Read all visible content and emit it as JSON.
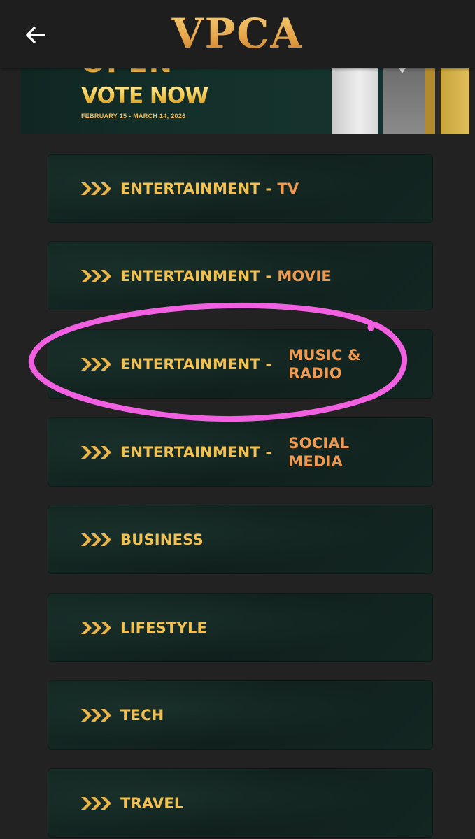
{
  "header": {
    "logo": "VPCA",
    "back_icon": "arrow-left-icon"
  },
  "banner": {
    "open_text": "OPEN",
    "title": "VOTE NOW",
    "dates": "FEBRUARY 15 - MARCH 14, 2026"
  },
  "categories": [
    {
      "main": "ENTERTAINMENT -",
      "sub": "TV"
    },
    {
      "main": "ENTERTAINMENT -",
      "sub": "MOVIE"
    },
    {
      "main": "ENTERTAINMENT -",
      "sub": "MUSIC & RADIO"
    },
    {
      "main": "ENTERTAINMENT -",
      "sub": "SOCIAL MEDIA"
    },
    {
      "main": "BUSINESS",
      "sub": ""
    },
    {
      "main": "LIFESTYLE",
      "sub": ""
    },
    {
      "main": "TECH",
      "sub": ""
    },
    {
      "main": "TRAVEL",
      "sub": ""
    }
  ],
  "colors": {
    "background": "#222222",
    "card": "#122420",
    "gold": "#f2c154",
    "orange": "#ef9a50",
    "annotation": "#f060e0"
  }
}
